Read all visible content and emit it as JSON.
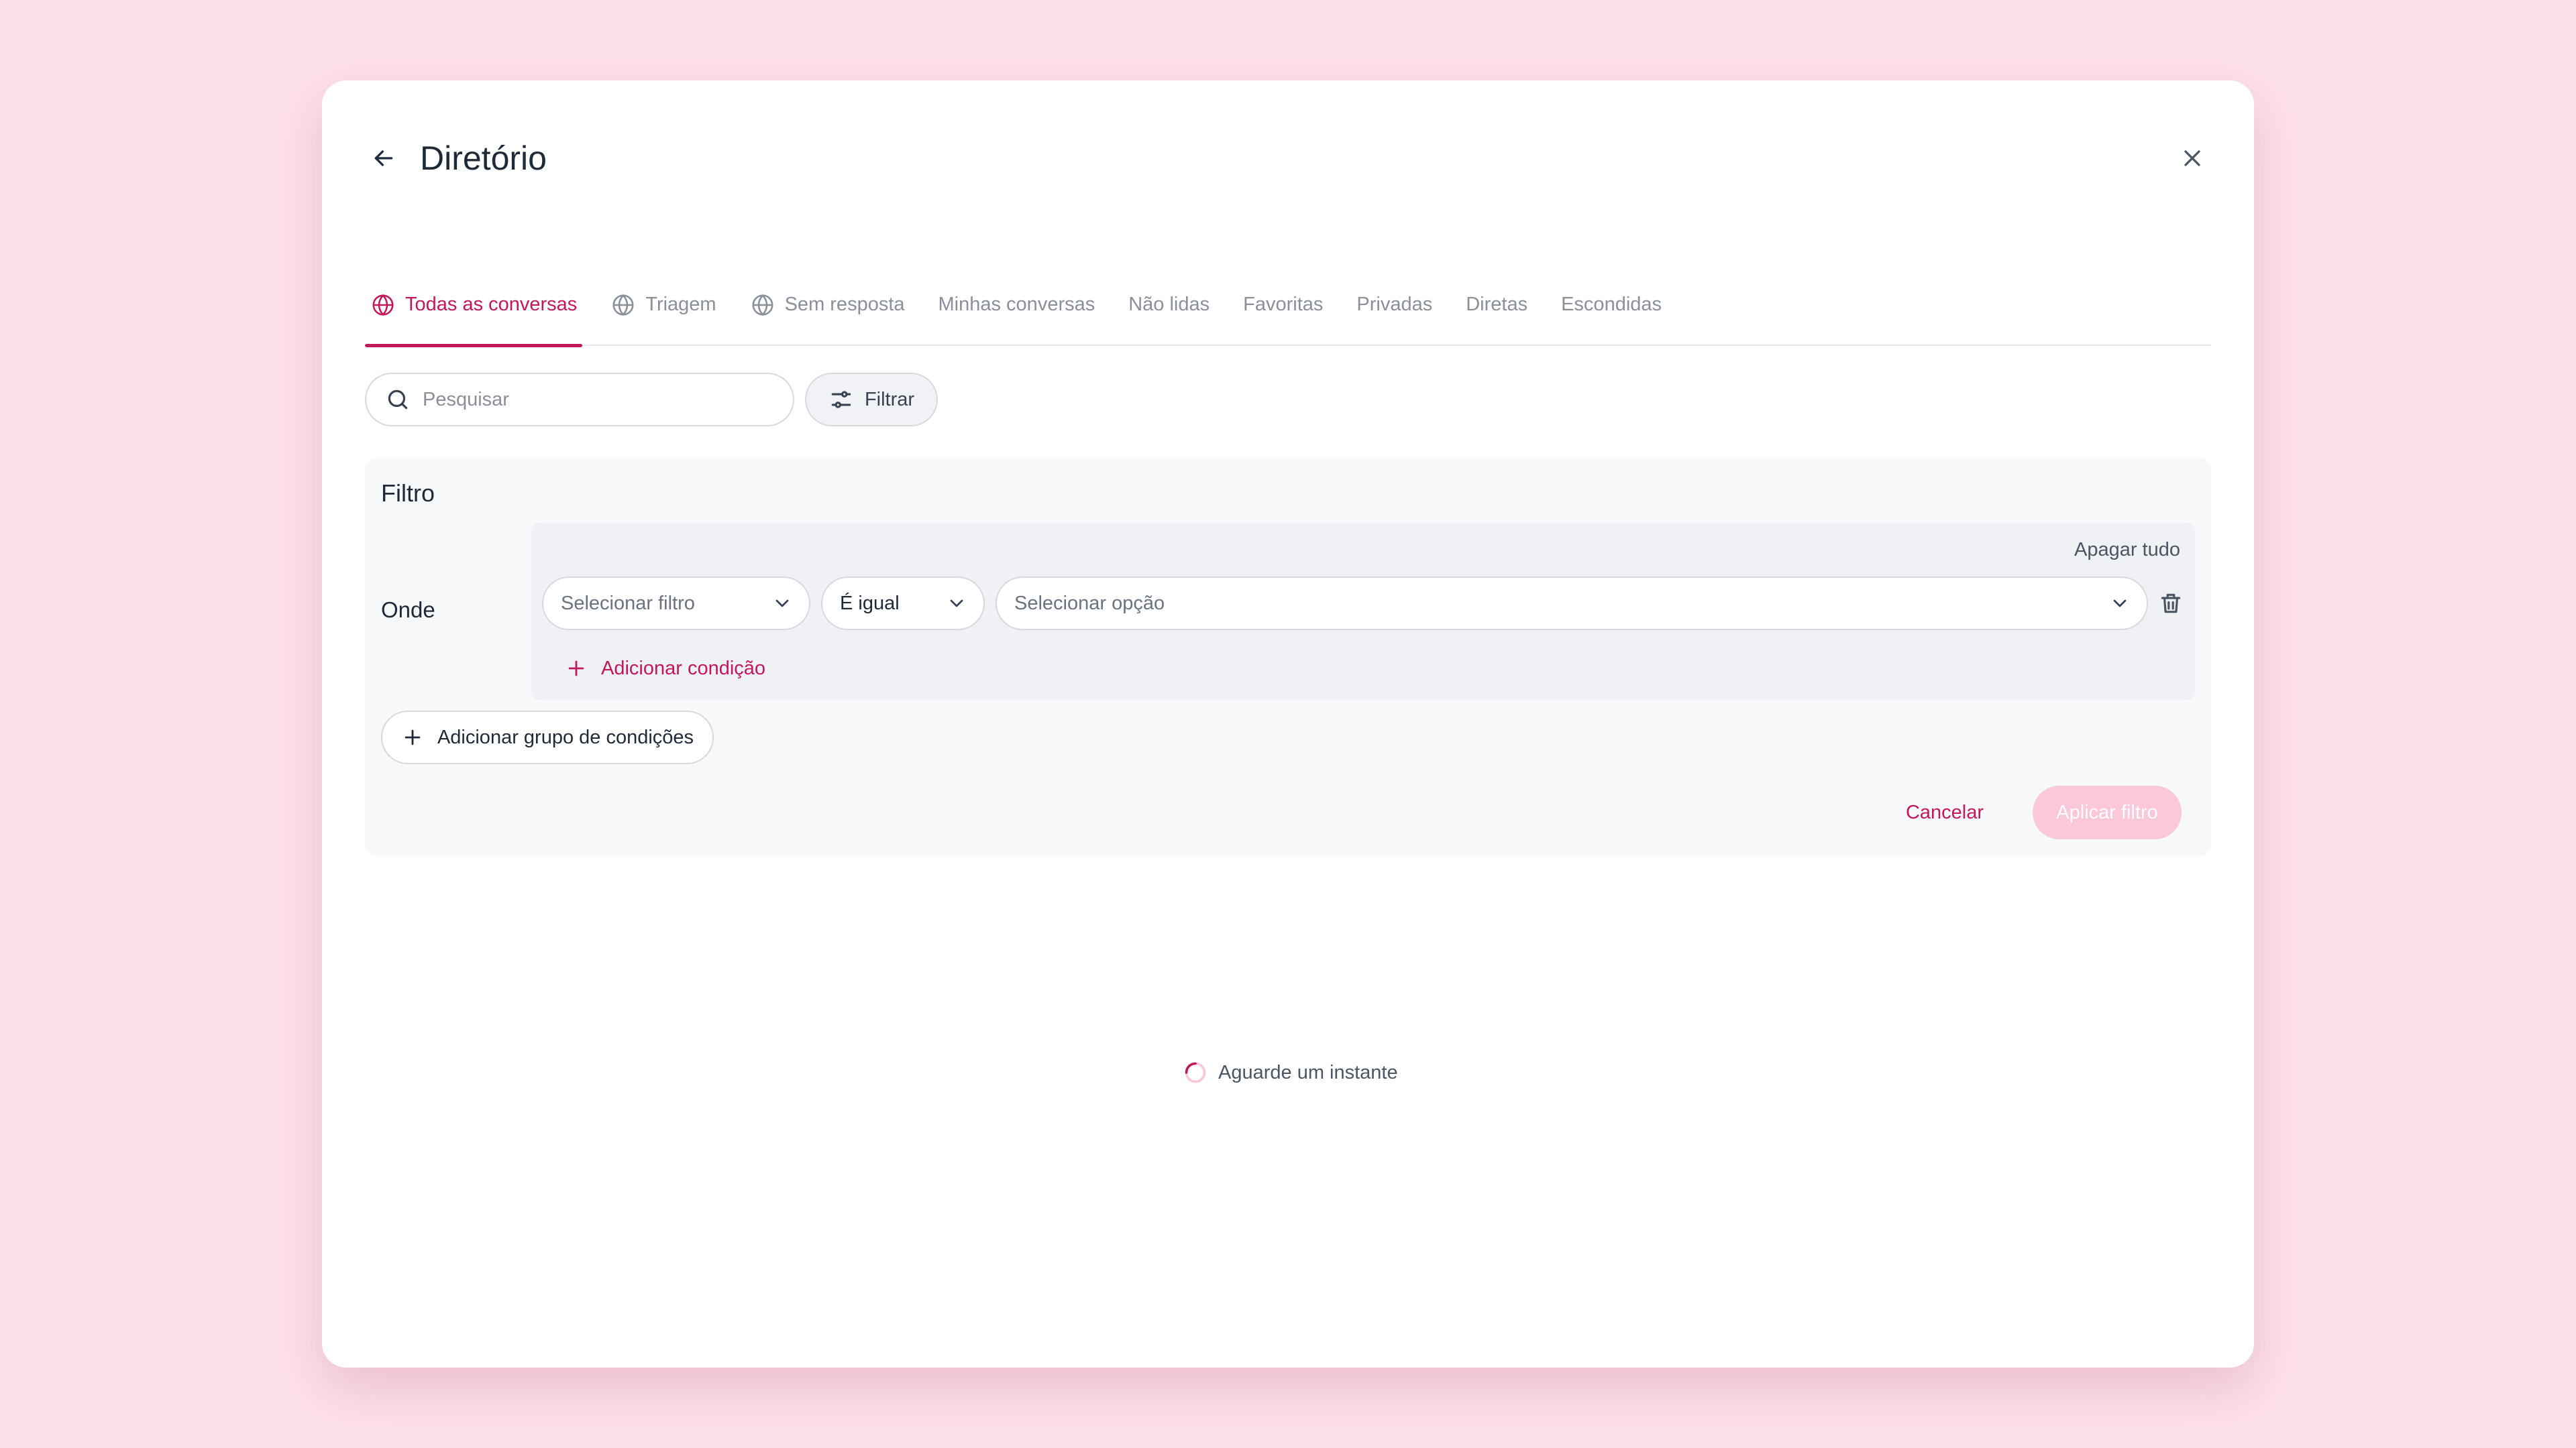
{
  "header": {
    "title": "Diretório"
  },
  "tabs": [
    {
      "label": "Todas as conversas",
      "icon": "globe-icon",
      "active": true
    },
    {
      "label": "Triagem",
      "icon": "globe-icon",
      "active": false
    },
    {
      "label": "Sem resposta",
      "icon": "globe-icon",
      "active": false
    },
    {
      "label": "Minhas conversas",
      "active": false
    },
    {
      "label": "Não lidas",
      "active": false
    },
    {
      "label": "Favoritas",
      "active": false
    },
    {
      "label": "Privadas",
      "active": false
    },
    {
      "label": "Diretas",
      "active": false
    },
    {
      "label": "Escondidas",
      "active": false
    }
  ],
  "search": {
    "placeholder": "Pesquisar",
    "value": ""
  },
  "toolbar": {
    "filter_label": "Filtrar"
  },
  "filter": {
    "title": "Filtro",
    "where_label": "Onde",
    "clear_all_label": "Apagar tudo",
    "condition": {
      "field_placeholder": "Selecionar filtro",
      "operator_value": "É igual",
      "option_placeholder": "Selecionar opção"
    },
    "add_condition_label": "Adicionar condição",
    "add_group_label": "Adicionar grupo de condições",
    "cancel_label": "Cancelar",
    "apply_label": "Aplicar filtro"
  },
  "status": {
    "loading_text": "Aguarde um instante"
  },
  "colors": {
    "accent": "#c2185b",
    "accent_disabled": "#fbc7da",
    "backdrop": "#fde0ea"
  }
}
